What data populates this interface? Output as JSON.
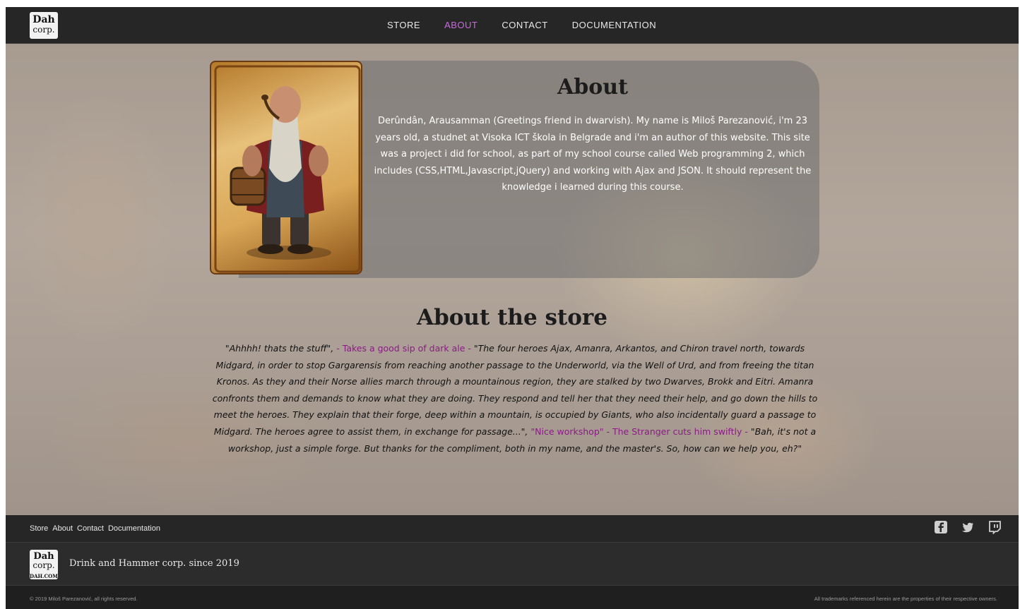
{
  "brand": {
    "logo_line1": "Dah",
    "logo_line2": "corp.",
    "logo_line3": "DAH.COM"
  },
  "nav": {
    "items": [
      {
        "label": "STORE"
      },
      {
        "label": "ABOUT",
        "active": true
      },
      {
        "label": "CONTACT"
      },
      {
        "label": "DOCUMENTATION"
      }
    ],
    "active_color": "#c96bdc"
  },
  "about": {
    "title": "About",
    "text": "Derûndân, Arausamman (Greetings friend in dwarvish). My name is Miloš Parezanović, i'm 23 years old, a studnet at Visoka ICT škola in Belgrade and i'm an author of this website. This site was a project i did for school, as part of my school course called Web programming 2, which includes (CSS,HTML,Javascript,jQuery) and working with Ajax and JSON. It should represent the knowledge i learned during this course."
  },
  "store": {
    "title": "About the store",
    "p1": "\"Ahhhh! thats the stuff\",",
    "p2": "- Takes a good sip of dark ale -",
    "p3": "\"The four heroes Ajax, Amanra, Arkantos, and Chiron travel north, towards Midgard, in order to stop Gargarensis from reaching another passage to the Underworld, via the Well of Urd, and from freeing the titan Kronos. As they and their Norse allies march through a mountainous region, they are stalked by two Dwarves, Brokk and Eitri. Amanra confronts them and demands to know what they are doing. They respond and tell her that they need their help, and go down the hills to meet the heroes. They explain that their forge, deep within a mountain, is occupied by Giants, who also incidentally guard a passage to Midgard. The heroes agree to assist them, in exchange for passage...\",",
    "p4": "\"Nice workshop\" - The Stranger cuts him swiftly -",
    "p5": "\"Bah, it's not a workshop, just a simple forge. But thanks for the compliment, both in my name, and the master's. So, how can we help you, eh?\"",
    "highlight_color": "#8b1a86"
  },
  "footer": {
    "links": [
      {
        "label": "Store"
      },
      {
        "label": "About"
      },
      {
        "label": "Contact"
      },
      {
        "label": "Documentation"
      }
    ],
    "social_icons": [
      "facebook-icon",
      "twitter-icon",
      "twitch-icon"
    ],
    "tagline": "Drink and Hammer corp. since 2019",
    "copyright": "© 2019 Miloš Parezanović, all rights reserved.",
    "trademark": "All trademarks referenced herein are the properties of their respective owners."
  }
}
